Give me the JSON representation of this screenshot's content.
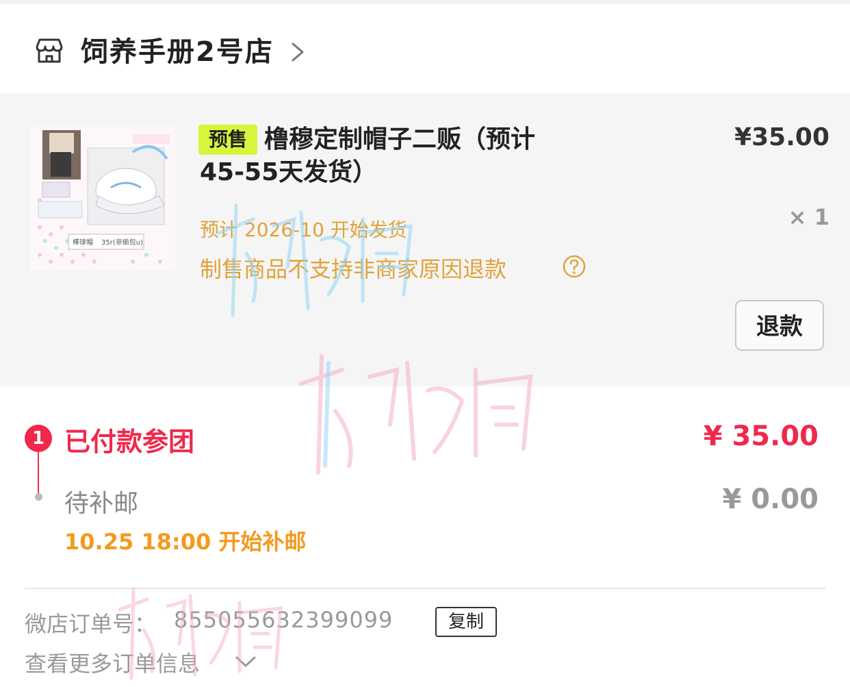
{
  "shop": {
    "name": "饲养手册2号店",
    "icon": "store-icon",
    "chevron": "chevron-right-icon"
  },
  "product": {
    "badge": "预售",
    "title": "橹穆定制帽子二贩（预计45-55天发货）",
    "price": "¥35.00",
    "quantity": "× 1",
    "ship_note": "预计 2026-10 开始发货",
    "refund_note": "制售商品不支持非商家原因退款",
    "help_icon": "question-circle-icon",
    "refund_button": "退款",
    "thumbnail": {
      "label_left": "棒球帽",
      "label_right": "35r(非偷包u)"
    }
  },
  "payment_steps": {
    "step1_number": "1",
    "step1_label": "已付款参团",
    "step1_amount": "¥ 35.00",
    "step2_label": "待补邮",
    "step2_amount": "¥ 0.00",
    "step2_time": "10.25 18:00 开始补邮"
  },
  "order": {
    "number_label": "微店订单号：",
    "number": "855055632399099",
    "copy_button": "复制",
    "more_info": "查看更多订单信息"
  },
  "watermark": {
    "text": "折枳雨"
  },
  "colors": {
    "accent_red": "#f0284c",
    "presale_green": "#d6f53b",
    "note_orange": "#e0a23a",
    "time_orange": "#f39a1e"
  }
}
